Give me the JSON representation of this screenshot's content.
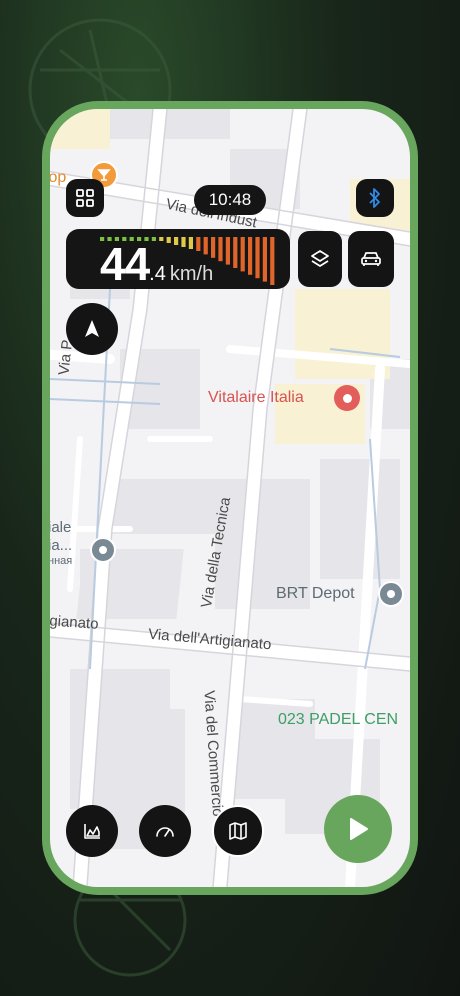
{
  "status": {
    "time": "10:48"
  },
  "speedometer": {
    "speed_integer": "44",
    "speed_decimal": ".4",
    "unit": "km/h",
    "bar_colors": {
      "low": "#7cc142",
      "mid": "#e0c94a",
      "high": "#e0652b"
    }
  },
  "map": {
    "labels": {
      "poi_top_left": "top",
      "street_industria": "Via dell'Indust",
      "street_p": "Via P",
      "street_tecnica": "Via della Tecnica",
      "street_artigianato_left": "igianato",
      "street_artigianato": "Via dell'Artigianato",
      "street_commercio": "Via del Commercio",
      "poi_vitalaire": "Vitalaire Italia",
      "poi_brt": "BRT Depot",
      "poi_padel": "023 PADEL CEN",
      "poi_left_line1": "iale",
      "poi_left_line2": "ia...",
      "poi_left_line3": "нная"
    }
  },
  "icons": {
    "grid": "grid-icon",
    "bluetooth": "bluetooth-icon",
    "layers": "layers-icon",
    "car": "car-icon",
    "compass": "compass-arrow-icon",
    "stats": "chart-icon",
    "gauge": "gauge-icon",
    "map": "map-icon",
    "play": "play-icon"
  },
  "colors": {
    "accent_green": "#69a65d",
    "bluetooth_blue": "#2f8ce6",
    "poi_red": "#e35d5b",
    "poi_orange": "#f29b3a",
    "poi_grey": "#7a8a95",
    "padel_green": "#3d9e66"
  }
}
